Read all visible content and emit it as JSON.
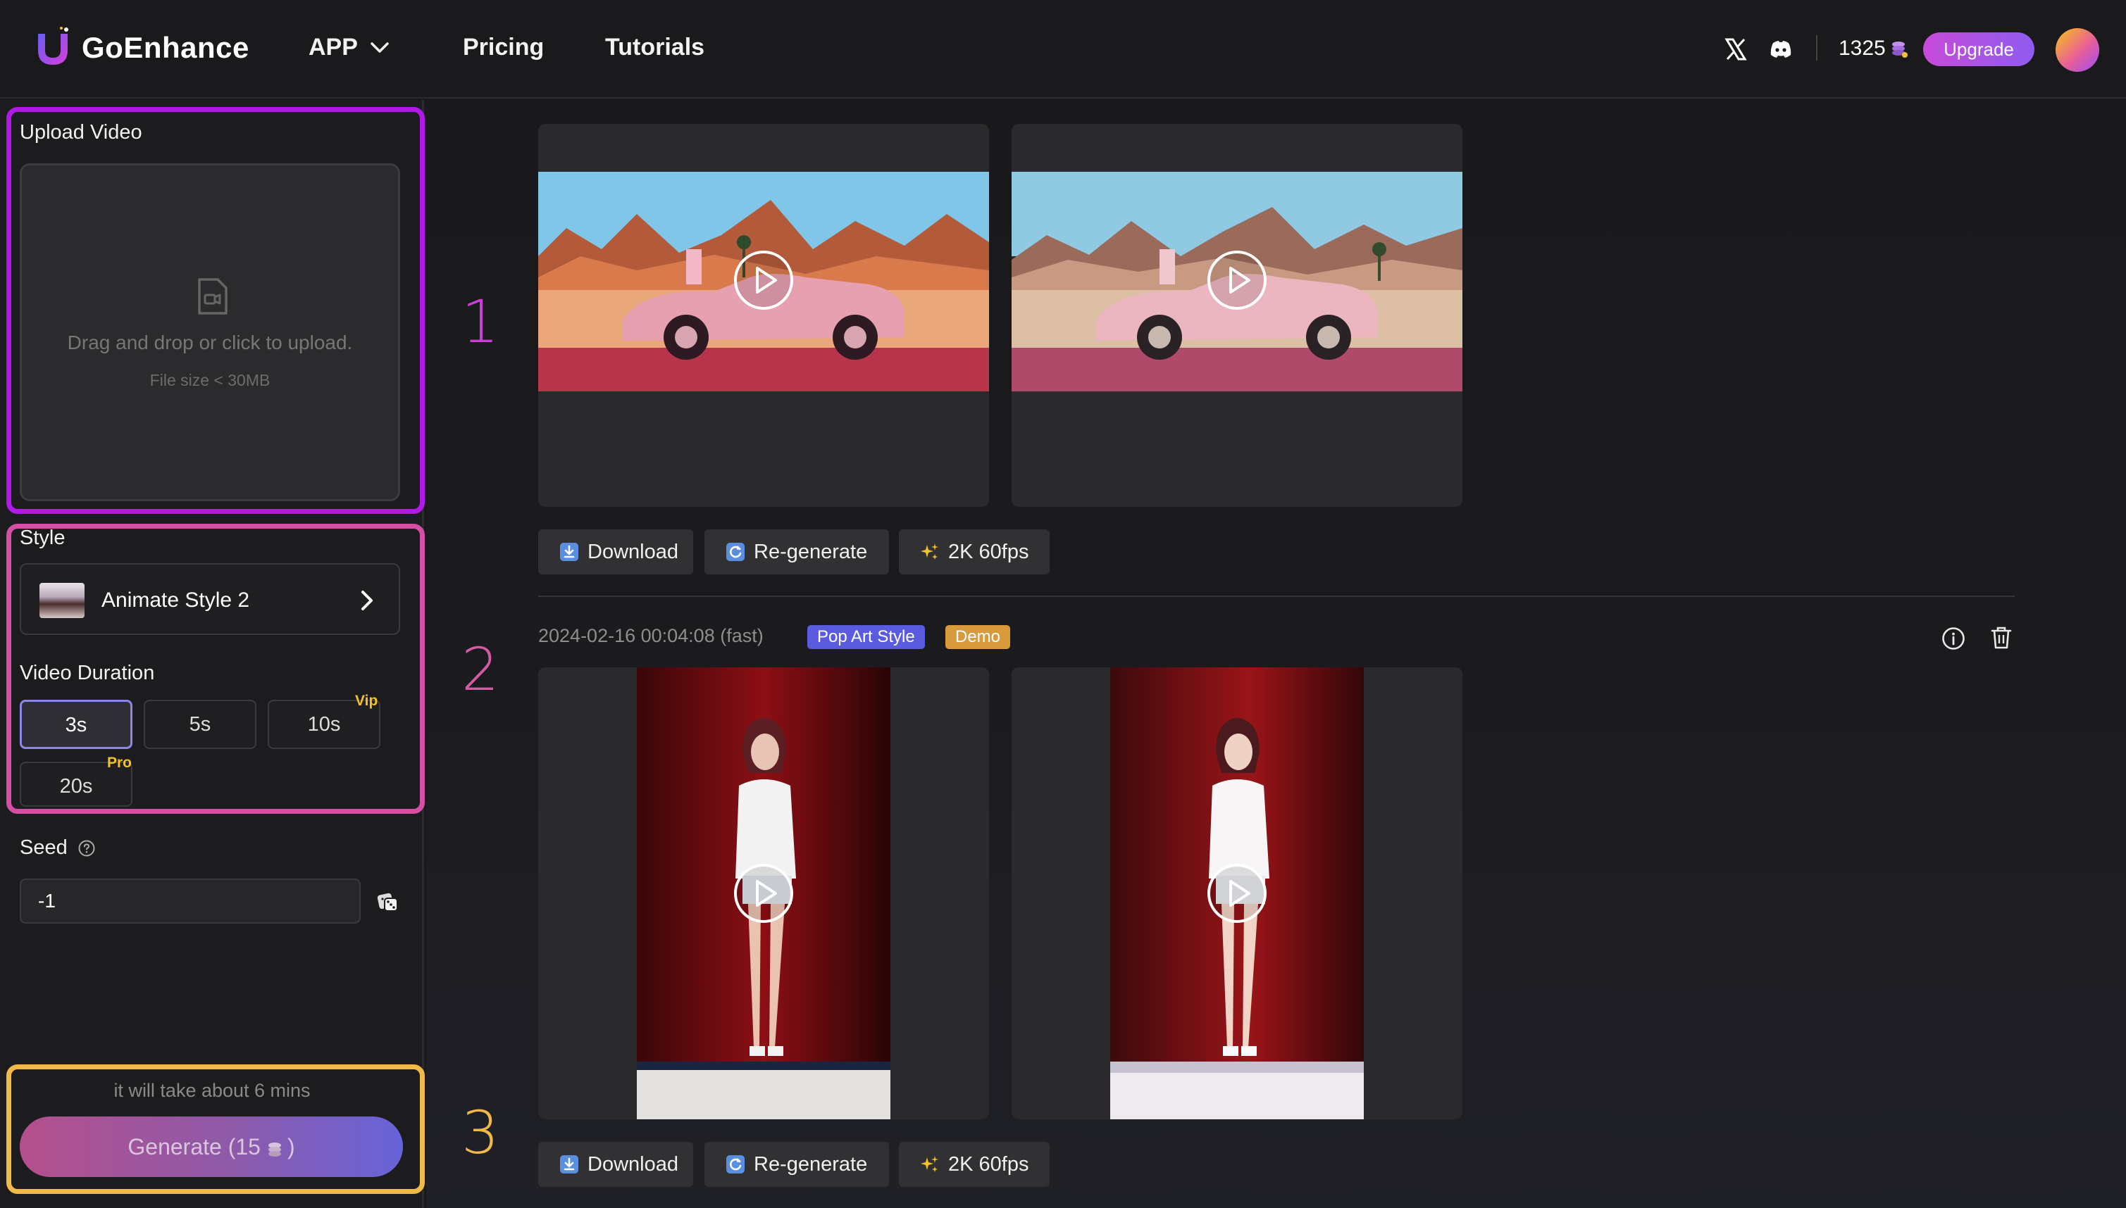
{
  "header": {
    "brand": "GoEnhance",
    "nav": {
      "app": "APP",
      "pricing": "Pricing",
      "tutorials": "Tutorials"
    },
    "credits": "1325",
    "upgrade": "Upgrade"
  },
  "left_panel": {
    "upload": {
      "label": "Upload Video",
      "drop_text": "Drag and drop or click to upload.",
      "file_limit": "File size < 30MB"
    },
    "style": {
      "label": "Style",
      "selected": "Animate Style 2"
    },
    "duration": {
      "label": "Video Duration",
      "options": [
        {
          "label": "3s",
          "selected": true
        },
        {
          "label": "5s"
        },
        {
          "label": "10s",
          "tag": "Vip"
        },
        {
          "label": "20s",
          "tag": "Pro"
        }
      ]
    },
    "seed": {
      "label": "Seed",
      "value": "-1"
    },
    "time_note": "it will take about 6 mins",
    "generate": {
      "label_prefix": "Generate (15",
      "label_suffix": ")"
    }
  },
  "main": {
    "annotations": [
      "1",
      "2",
      "3"
    ],
    "actions": {
      "download": "Download",
      "regenerate": "Re-generate",
      "upscale": "2K 60fps"
    },
    "job2": {
      "timestamp": "2024-02-16 00:04:08 (fast)",
      "badges": [
        "Pop Art Style",
        "Demo"
      ]
    }
  },
  "colors": {
    "highlight_upload": "#b119e8",
    "highlight_settings": "#d44fa5",
    "highlight_generate": "#f0b94a",
    "upgrade_gradient": [
      "#c74bd8",
      "#8f5cf0"
    ],
    "badge_style": "#5b5be0",
    "badge_demo": "#d89a3a"
  },
  "icons": [
    "x-icon",
    "discord-icon",
    "coins-icon",
    "file-video-icon",
    "chevron-right-icon",
    "help-icon",
    "dice-icon",
    "play-icon",
    "download-icon",
    "refresh-icon",
    "sparkles-icon",
    "info-icon",
    "trash-icon"
  ]
}
